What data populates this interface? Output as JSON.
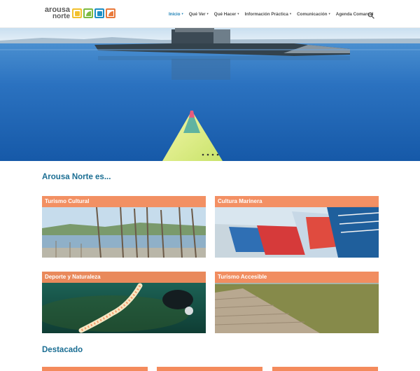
{
  "header": {
    "logo": {
      "line1": "arousa",
      "line2": "norte",
      "marks": [
        {
          "name": "logo-mark-yellow",
          "color": "#f2c12e"
        },
        {
          "name": "logo-mark-green",
          "color": "#7dbb42"
        },
        {
          "name": "logo-mark-blue",
          "color": "#1f8fc4"
        },
        {
          "name": "logo-mark-orange",
          "color": "#e9793b"
        }
      ]
    },
    "nav": [
      {
        "label": "Inicio",
        "active": true,
        "dropdown": true
      },
      {
        "label": "Qué Ver",
        "active": false,
        "dropdown": true
      },
      {
        "label": "Qué Hacer",
        "active": false,
        "dropdown": true
      },
      {
        "label": "Información Práctica",
        "active": false,
        "dropdown": true
      },
      {
        "label": "Comunicación",
        "active": false,
        "dropdown": true
      },
      {
        "label": "Agenda Comarcal",
        "active": false,
        "dropdown": false
      }
    ],
    "search_icon": "search-icon",
    "caret_glyph": "▾"
  },
  "hero": {
    "description": "kayak bow on calm blue water with mussel rafts"
  },
  "sections": {
    "intro_title": "Arousa Norte es...",
    "featured_title": "Destacado"
  },
  "cards": [
    {
      "label": "Turismo Cultural"
    },
    {
      "label": "Cultura Marinera"
    },
    {
      "label": "Deporte y Naturaleza"
    },
    {
      "label": "Turismo Accesible"
    }
  ],
  "colors": {
    "accent": "#f48b5c",
    "title": "#1b6e93",
    "nav_active": "#1a7fb5"
  }
}
